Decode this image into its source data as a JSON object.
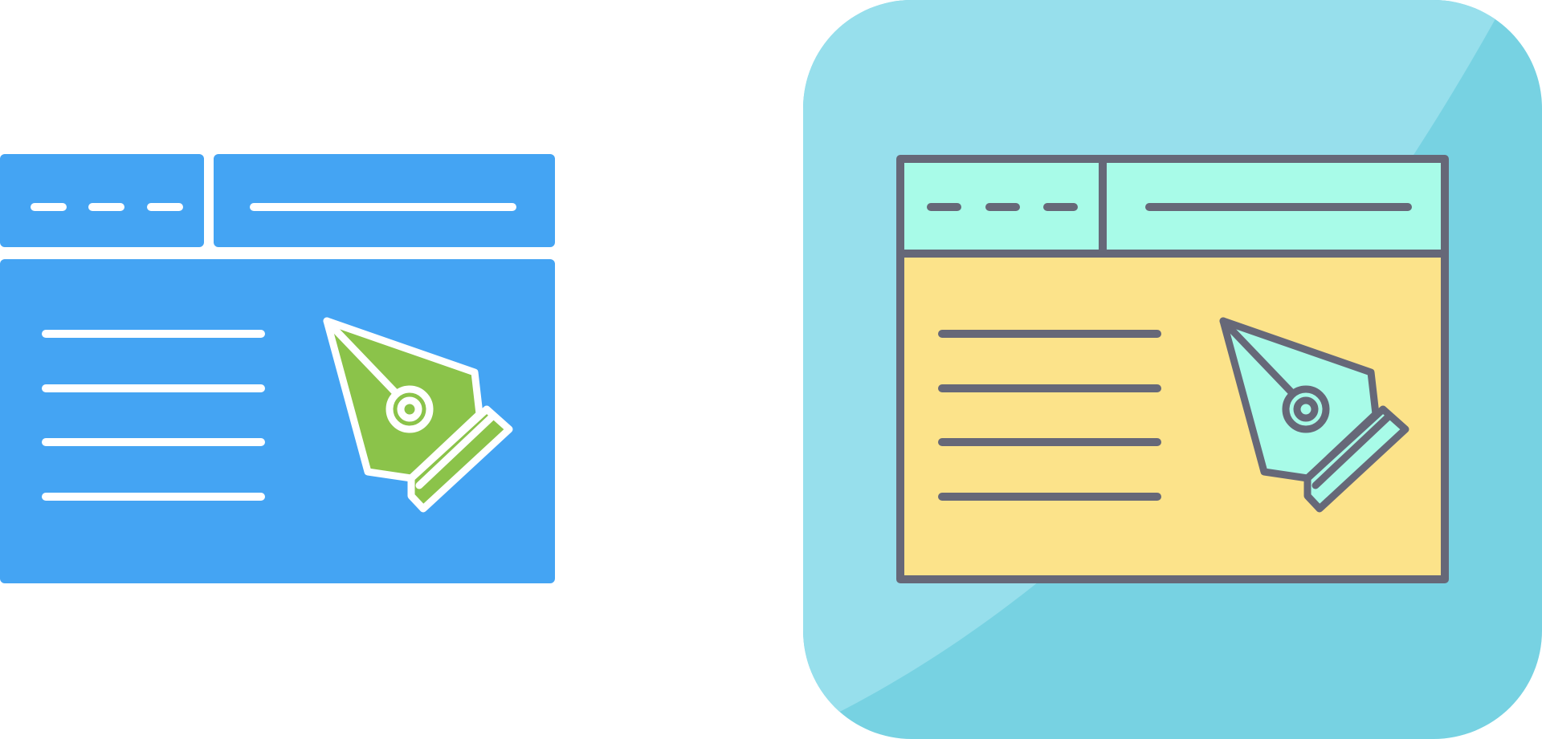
{
  "colors": {
    "background": "#ffffff",
    "glyph_fill": "#44a4f3",
    "glyph_stroke": "#ffffff",
    "glyph_nib": "#8bc34a",
    "tile_light": "#97dfec",
    "tile_dark": "#77d2e2",
    "outline_stroke": "#666878",
    "outline_header": "#a8fbe8",
    "outline_body": "#fce38a",
    "outline_nib": "#a8fbe8"
  },
  "icons": [
    {
      "name": "web-design-glyph-icon",
      "style": "glyph"
    },
    {
      "name": "web-design-filled-outline-icon",
      "style": "filled-outline"
    }
  ]
}
